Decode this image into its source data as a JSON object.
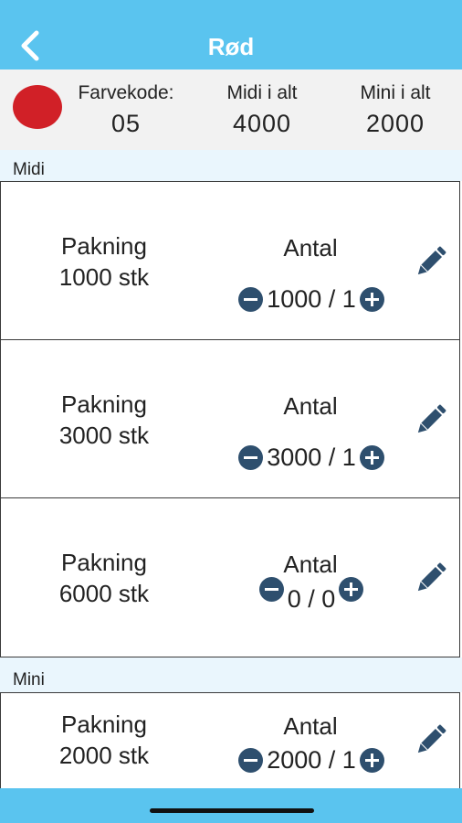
{
  "header": {
    "title": "Rød"
  },
  "summary": {
    "color_hex": "#d12027",
    "farvekode_label": "Farvekode:",
    "farvekode_value": "05",
    "midi_label": "Midi i alt",
    "midi_value": "4000",
    "mini_label": "Mini i alt",
    "mini_value": "2000"
  },
  "sections": {
    "midi": {
      "label": "Midi",
      "items": [
        {
          "pakning_label": "Pakning",
          "size": "1000 stk",
          "antal_label": "Antal",
          "count": "1000 / 1"
        },
        {
          "pakning_label": "Pakning",
          "size": "3000 stk",
          "antal_label": "Antal",
          "count": "3000 / 1"
        },
        {
          "pakning_label": "Pakning",
          "size": "6000 stk",
          "antal_label": "Antal",
          "count": "0 / 0"
        }
      ]
    },
    "mini": {
      "label": "Mini",
      "items": [
        {
          "pakning_label": "Pakning",
          "size": "2000 stk",
          "antal_label": "Antal",
          "count": "2000 / 1"
        }
      ]
    }
  },
  "icons": {
    "back": "back-chevron-icon",
    "edit": "pencil-icon",
    "minus": "minus-circle-icon",
    "plus": "plus-circle-icon"
  },
  "colors": {
    "bar": "#5ac4ef",
    "button": "#2e4f6e"
  }
}
